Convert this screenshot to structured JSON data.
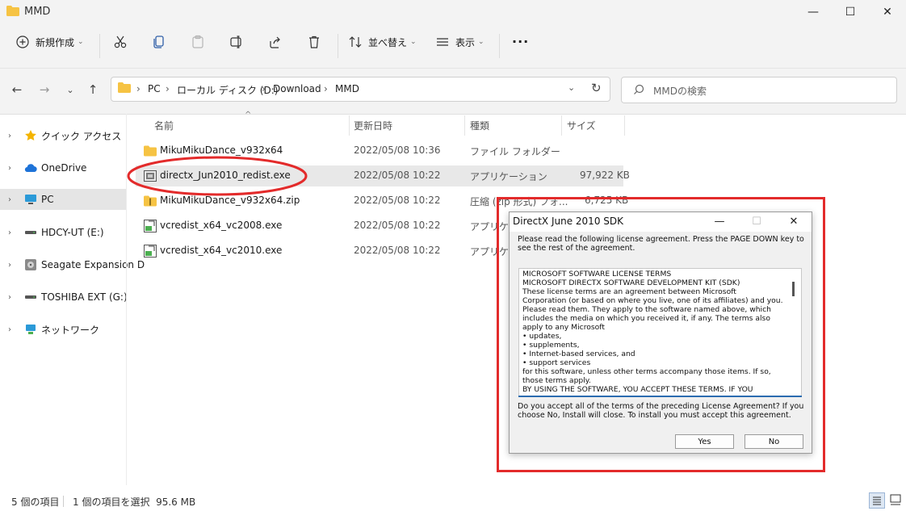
{
  "window": {
    "title": "MMD",
    "minimize": "—",
    "maximize": "☐",
    "close": "✕"
  },
  "toolbar": {
    "new_label": "新規作成",
    "sort_label": "並べ替え",
    "view_label": "表示",
    "more_label": "···"
  },
  "nav": {
    "back_icon": "←",
    "forward_icon": "→",
    "recent_icon": "⌄",
    "up_icon": "↑",
    "breadcrumb": [
      "PC",
      "ローカル ディスク (D:)",
      "Download",
      "MMD"
    ],
    "breadcrumb_sep": "›",
    "expand_icon": "⌄",
    "refresh_icon": "↻",
    "search_placeholder": "MMDの検索"
  },
  "sidebar": {
    "items": [
      {
        "label": "クイック アクセス",
        "icon": "star-icon"
      },
      {
        "label": "OneDrive",
        "icon": "cloud-icon"
      },
      {
        "label": "PC",
        "icon": "monitor-icon"
      },
      {
        "label": "HDCY-UT (E:)",
        "icon": "drive-icon"
      },
      {
        "label": "Seagate Expansion D",
        "icon": "hdd-icon"
      },
      {
        "label": "TOSHIBA EXT (G:)",
        "icon": "drive-icon"
      },
      {
        "label": "ネットワーク",
        "icon": "network-icon"
      }
    ],
    "chevron": "›"
  },
  "files": {
    "columns": {
      "name": "名前",
      "date": "更新日時",
      "type": "種類",
      "size": "サイズ"
    },
    "sort_caret": "^",
    "rows": [
      {
        "name": "MikuMikuDance_v932x64",
        "date": "2022/05/08 10:36",
        "type": "ファイル フォルダー",
        "size": ""
      },
      {
        "name": "directx_Jun2010_redist.exe",
        "date": "2022/05/08 10:22",
        "type": "アプリケーション",
        "size": "97,922 KB"
      },
      {
        "name": "MikuMikuDance_v932x64.zip",
        "date": "2022/05/08 10:22",
        "type": "圧縮 (zip 形式) フォ...",
        "size": "6,725 KB"
      },
      {
        "name": "vcredist_x64_vc2008.exe",
        "date": "2022/05/08 10:22",
        "type": "アプリケーション",
        "size": ""
      },
      {
        "name": "vcredist_x64_vc2010.exe",
        "date": "2022/05/08 10:22",
        "type": "アプリケーション",
        "size": ""
      }
    ]
  },
  "dialog": {
    "title": "DirectX June 2010 SDK",
    "minimize": "—",
    "maximize": "☐",
    "close": "✕",
    "prompt": "Please read the following license agreement. Press the PAGE DOWN key to see the rest of the agreement.",
    "license_lines": [
      "MICROSOFT SOFTWARE LICENSE TERMS",
      "MICROSOFT DIRECTX SOFTWARE DEVELOPMENT KIT (SDK)",
      "These license terms are an agreement between Microsoft",
      "Corporation (or based on where you live, one of its affiliates) and you.",
      "Please read them. They apply to the software named above, which",
      "includes the media on which you received it, if any. The terms also",
      "apply to any Microsoft",
      "• updates,",
      "• supplements,",
      "• Internet-based services, and",
      "• support services",
      "for this software, unless other terms accompany those items. If so,",
      "those terms apply.",
      "BY USING THE SOFTWARE, YOU ACCEPT THESE TERMS. IF YOU"
    ],
    "question": "Do you accept all of the terms of the preceding License Agreement? If you choose No, Install will close. To install you must accept this agreement.",
    "yes_label": "Yes",
    "no_label": "No"
  },
  "status": {
    "item_count": "5 個の項目",
    "selection": "1 個の項目を選択  95.6 MB"
  },
  "colors": {
    "highlight": "#e32b2b",
    "selected_row": "#e8e8e8",
    "accent": "#2b6cb0"
  }
}
